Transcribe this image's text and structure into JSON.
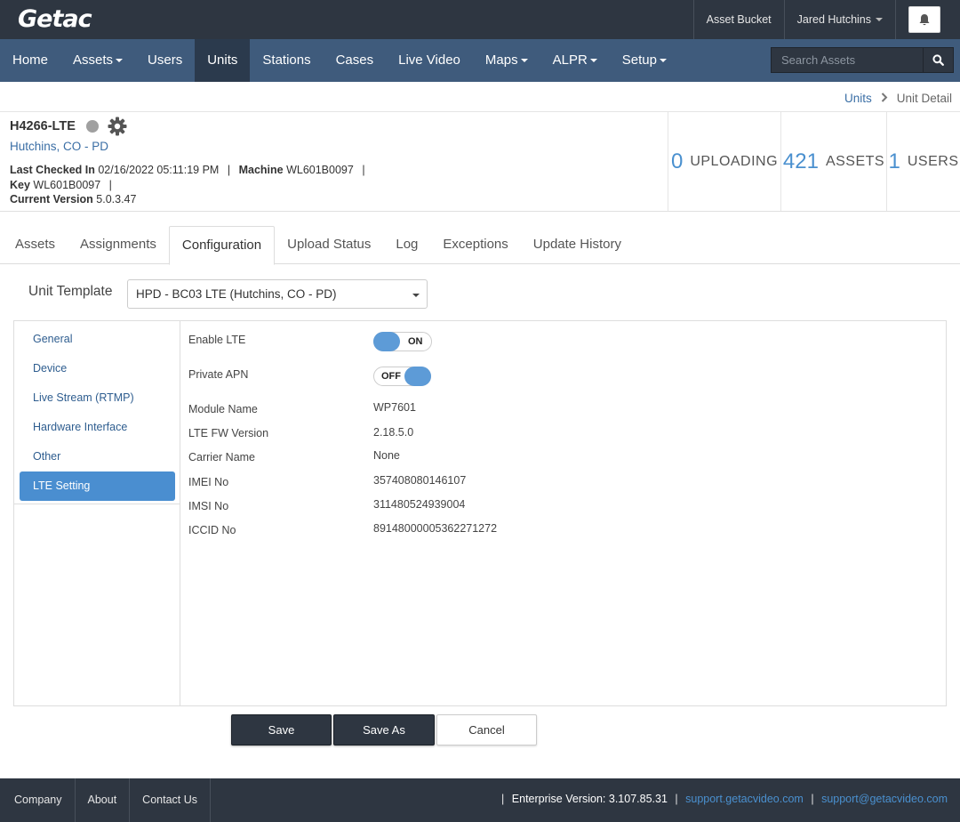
{
  "brand": {
    "logo": "Getac"
  },
  "topbar": {
    "asset_bucket": "Asset Bucket",
    "user_name": "Jared Hutchins"
  },
  "nav": {
    "items": [
      {
        "label": "Home",
        "has_dropdown": false,
        "active": false
      },
      {
        "label": "Assets",
        "has_dropdown": true,
        "active": false
      },
      {
        "label": "Users",
        "has_dropdown": false,
        "active": false
      },
      {
        "label": "Units",
        "has_dropdown": false,
        "active": true
      },
      {
        "label": "Stations",
        "has_dropdown": false,
        "active": false
      },
      {
        "label": "Cases",
        "has_dropdown": false,
        "active": false
      },
      {
        "label": "Live Video",
        "has_dropdown": false,
        "active": false
      },
      {
        "label": "Maps",
        "has_dropdown": true,
        "active": false
      },
      {
        "label": "ALPR",
        "has_dropdown": true,
        "active": false
      },
      {
        "label": "Setup",
        "has_dropdown": true,
        "active": false
      }
    ],
    "search_placeholder": "Search Assets",
    "search_value": ""
  },
  "breadcrumb": {
    "parent": "Units",
    "current": "Unit Detail"
  },
  "unit": {
    "name": "H4266-LTE",
    "agency": "Hutchins, CO - PD",
    "status_color": "#a0a0a0",
    "last_checked_label": "Last Checked In",
    "last_checked_value": "02/16/2022 05:11:19 PM",
    "machine_label": "Machine",
    "machine_value": "WL601B0097",
    "key_label": "Key",
    "key_value": "WL601B0097",
    "version_label": "Current Version",
    "version_value": "5.0.3.47"
  },
  "stats": [
    {
      "count": "0",
      "label": "UPLOADING"
    },
    {
      "count": "421",
      "label": "ASSETS"
    },
    {
      "count": "1",
      "label": "USERS"
    }
  ],
  "tabs": [
    {
      "label": "Assets",
      "active": false
    },
    {
      "label": "Assignments",
      "active": false
    },
    {
      "label": "Configuration",
      "active": true
    },
    {
      "label": "Upload Status",
      "active": false
    },
    {
      "label": "Log",
      "active": false
    },
    {
      "label": "Exceptions",
      "active": false
    },
    {
      "label": "Update History",
      "active": false
    }
  ],
  "template": {
    "label": "Unit Template",
    "selected": "HPD - BC03 LTE (Hutchins, CO - PD)"
  },
  "config_menu": [
    {
      "label": "General",
      "active": false
    },
    {
      "label": "Device",
      "active": false
    },
    {
      "label": "Live Stream (RTMP)",
      "active": false
    },
    {
      "label": "Hardware Interface",
      "active": false
    },
    {
      "label": "Other",
      "active": false
    },
    {
      "label": "LTE Setting",
      "active": true
    }
  ],
  "lte": {
    "enable_lte": {
      "label": "Enable LTE",
      "state": "ON"
    },
    "private_apn": {
      "label": "Private APN",
      "state": "OFF"
    },
    "fields": [
      {
        "label": "Module Name",
        "value": "WP7601"
      },
      {
        "label": "LTE FW Version",
        "value": "2.18.5.0"
      },
      {
        "label": "Carrier Name",
        "value": "None"
      },
      {
        "label": "IMEI No",
        "value": "357408080146107"
      },
      {
        "label": "IMSI No",
        "value": "311480524939004"
      },
      {
        "label": "ICCID No",
        "value": "89148000005362271272"
      }
    ]
  },
  "actions": {
    "save": "Save",
    "save_as": "Save As",
    "cancel": "Cancel"
  },
  "footer": {
    "links": [
      "Company",
      "About",
      "Contact Us"
    ],
    "version_label": "Enterprise Version: 3.107.85.31",
    "support_site": "support.getacvideo.com",
    "support_email": "support@getacvideo.com"
  },
  "colors": {
    "topbar": "#2e3641",
    "navbar": "#3f5b7c",
    "nav_active": "#2b3a4d",
    "accent": "#4a90cf",
    "link": "#3a6ea5"
  }
}
